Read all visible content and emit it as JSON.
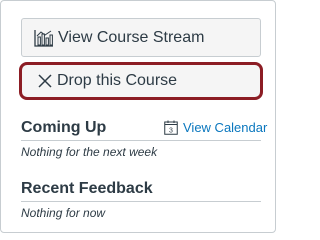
{
  "actions": {
    "view_stream_label": "View Course Stream",
    "drop_course_label": "Drop this Course"
  },
  "coming_up": {
    "title": "Coming Up",
    "view_calendar_label": "View Calendar",
    "calendar_day": "3",
    "empty_text": "Nothing for the next week"
  },
  "recent_feedback": {
    "title": "Recent Feedback",
    "empty_text": "Nothing for now"
  },
  "icons": {
    "stream": "bar-chart-icon",
    "drop": "x-icon",
    "calendar": "calendar-icon"
  },
  "colors": {
    "link": "#0a77be",
    "focus_ring": "#8c1d24",
    "button_bg": "#f5f5f5",
    "text": "#2d3b45"
  }
}
